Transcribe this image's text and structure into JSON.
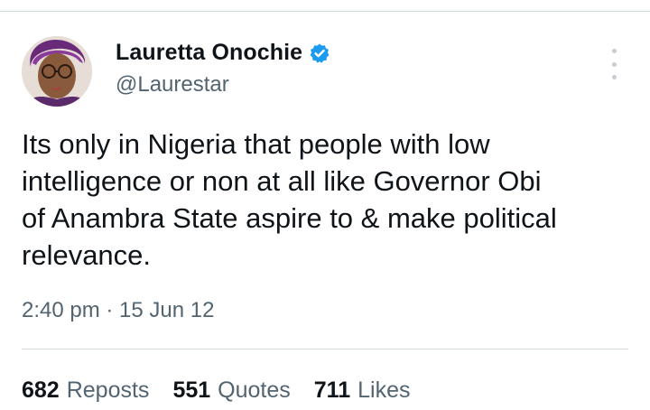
{
  "author": {
    "display_name": "Lauretta Onochie",
    "handle": "@Laurestar",
    "verified": true,
    "verified_color": "#1d9bf0"
  },
  "tweet": {
    "text": "Its only in Nigeria that people with low\nintelligence or non at all like Governor Obi\nof Anambra State aspire to & make political\nrelevance.",
    "timestamp": "2:40 pm · 15 Jun 12"
  },
  "stats": [
    {
      "count": "682",
      "label": "Reposts"
    },
    {
      "count": "551",
      "label": "Quotes"
    },
    {
      "count": "711",
      "label": "Likes"
    }
  ],
  "icons": {
    "verified": "verified-badge-icon",
    "more": "more-options-icon"
  }
}
